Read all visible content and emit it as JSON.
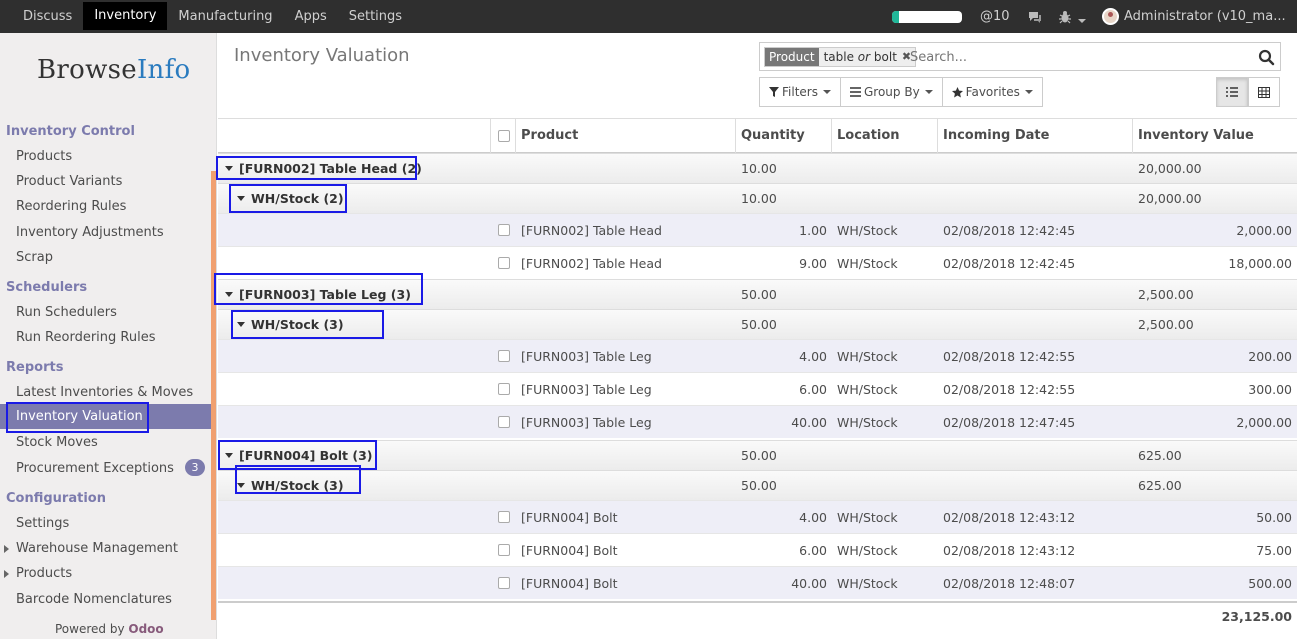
{
  "topbar": {
    "menu": [
      "Discuss",
      "Inventory",
      "Manufacturing",
      "Apps",
      "Settings"
    ],
    "active": "Inventory",
    "progress_pct": 10,
    "mentions": "@10",
    "user": "Administrator (v10_ma..."
  },
  "sidebar": {
    "logo_a": "Browse",
    "logo_b": "Info",
    "sections": [
      {
        "title": "Inventory Control",
        "items": [
          "Products",
          "Product Variants",
          "Reordering Rules",
          "Inventory Adjustments",
          "Scrap"
        ]
      },
      {
        "title": "Schedulers",
        "items": [
          "Run Schedulers",
          "Run Reordering Rules"
        ]
      },
      {
        "title": "Reports",
        "items": [
          "Latest Inventories & Moves",
          "Inventory Valuation",
          "Stock Moves",
          "Procurement Exceptions"
        ]
      },
      {
        "title": "Configuration",
        "items": [
          "Settings",
          "Warehouse Management",
          "Products",
          "Barcode Nomenclatures"
        ]
      }
    ],
    "badge": "3",
    "powered_prefix": "Powered by",
    "powered_brand": "Odoo"
  },
  "control_panel": {
    "title": "Inventory Valuation",
    "facet_label": "Product",
    "facet_value_1": "table",
    "facet_or": "or",
    "facet_value_2": "bolt",
    "search_placeholder": "Search...",
    "filters": "Filters",
    "group_by": "Group By",
    "favorites": "Favorites"
  },
  "table": {
    "columns": [
      "Product",
      "Quantity",
      "Location",
      "Incoming Date",
      "Inventory Value"
    ],
    "groups": [
      {
        "name": "[FURN002] Table Head (2)",
        "qty": "10.00",
        "value": "20,000.00",
        "sub": {
          "name": "WH/Stock (2)",
          "qty": "10.00",
          "value": "20,000.00"
        },
        "rows": [
          {
            "product": "[FURN002] Table Head",
            "qty": "1.00",
            "location": "WH/Stock",
            "date": "02/08/2018 12:42:45",
            "value": "2,000.00"
          },
          {
            "product": "[FURN002] Table Head",
            "qty": "9.00",
            "location": "WH/Stock",
            "date": "02/08/2018 12:42:45",
            "value": "18,000.00"
          }
        ]
      },
      {
        "name": "[FURN003] Table Leg (3)",
        "qty": "50.00",
        "value": "2,500.00",
        "sub": {
          "name": "WH/Stock (3)",
          "qty": "50.00",
          "value": "2,500.00"
        },
        "rows": [
          {
            "product": "[FURN003] Table Leg",
            "qty": "4.00",
            "location": "WH/Stock",
            "date": "02/08/2018 12:42:55",
            "value": "200.00"
          },
          {
            "product": "[FURN003] Table Leg",
            "qty": "6.00",
            "location": "WH/Stock",
            "date": "02/08/2018 12:42:55",
            "value": "300.00"
          },
          {
            "product": "[FURN003] Table Leg",
            "qty": "40.00",
            "location": "WH/Stock",
            "date": "02/08/2018 12:47:45",
            "value": "2,000.00"
          }
        ]
      },
      {
        "name": "[FURN004] Bolt (3)",
        "qty": "50.00",
        "value": "625.00",
        "sub": {
          "name": "WH/Stock (3)",
          "qty": "50.00",
          "value": "625.00"
        },
        "rows": [
          {
            "product": "[FURN004] Bolt",
            "qty": "4.00",
            "location": "WH/Stock",
            "date": "02/08/2018 12:43:12",
            "value": "50.00"
          },
          {
            "product": "[FURN004] Bolt",
            "qty": "6.00",
            "location": "WH/Stock",
            "date": "02/08/2018 12:43:12",
            "value": "75.00"
          },
          {
            "product": "[FURN004] Bolt",
            "qty": "40.00",
            "location": "WH/Stock",
            "date": "02/08/2018 12:48:07",
            "value": "500.00"
          }
        ]
      }
    ],
    "total": "23,125.00"
  },
  "colors": {
    "brand": "#7c7bad",
    "highlight": "#1a1ae6",
    "accent_bar": "#f0a070"
  }
}
